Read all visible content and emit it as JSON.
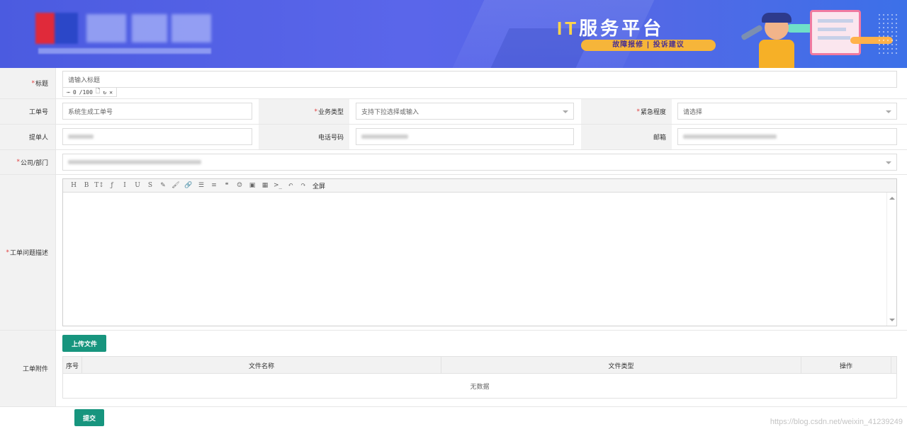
{
  "header": {
    "brand_prefix": "IT",
    "brand_title": "服务平台",
    "brand_tagline": "故障报修 | 投诉建议",
    "colors": {
      "banner": "#4b5be0",
      "accent": "#f6b53a",
      "brand_highlight": "#ffd54a"
    }
  },
  "form": {
    "title": {
      "label": "标题",
      "placeholder": "请输入标题",
      "count": "0",
      "max": "/100"
    },
    "order_no": {
      "label": "工单号",
      "placeholder": "系统生成工单号"
    },
    "business_type": {
      "label": "业务类型",
      "placeholder": "支持下拉选择或输入"
    },
    "urgency": {
      "label": "紧急程度",
      "placeholder": "请选择"
    },
    "submitter": {
      "label": "提单人"
    },
    "phone": {
      "label": "电话号码"
    },
    "email": {
      "label": "邮箱"
    },
    "company": {
      "label": "公司/部门"
    },
    "description": {
      "label": "工单问题描述"
    },
    "attachments": {
      "label": "工单附件",
      "upload_label": "上传文件"
    }
  },
  "editor": {
    "toolbar": [
      {
        "name": "heading-icon",
        "glyph": "H"
      },
      {
        "name": "bold-icon",
        "glyph": "B"
      },
      {
        "name": "font-size-icon",
        "glyph": "T↕"
      },
      {
        "name": "font-family-icon",
        "glyph": "ƒ"
      },
      {
        "name": "italic-icon",
        "glyph": "I"
      },
      {
        "name": "underline-icon",
        "glyph": "U"
      },
      {
        "name": "strikethrough-icon",
        "glyph": "S"
      },
      {
        "name": "text-color-icon",
        "glyph": "✎"
      },
      {
        "name": "background-color-icon",
        "glyph": "🖌"
      },
      {
        "name": "link-icon",
        "glyph": "🔗"
      },
      {
        "name": "list-icon",
        "glyph": "☰"
      },
      {
        "name": "align-icon",
        "glyph": "≡"
      },
      {
        "name": "quote-icon",
        "glyph": "❝"
      },
      {
        "name": "emoji-icon",
        "glyph": "☺"
      },
      {
        "name": "image-icon",
        "glyph": "▣"
      },
      {
        "name": "table-icon",
        "glyph": "▦"
      },
      {
        "name": "code-icon",
        "glyph": ">_"
      },
      {
        "name": "undo-icon",
        "glyph": "↶"
      },
      {
        "name": "redo-icon",
        "glyph": "↷"
      }
    ],
    "fullscreen_label": "全屏"
  },
  "table": {
    "columns": [
      "序号",
      "文件名称",
      "文件类型",
      "操作"
    ],
    "empty_text": "无数据"
  },
  "submit_label": "提交",
  "watermark": "https://blog.csdn.net/weixin_41239249"
}
